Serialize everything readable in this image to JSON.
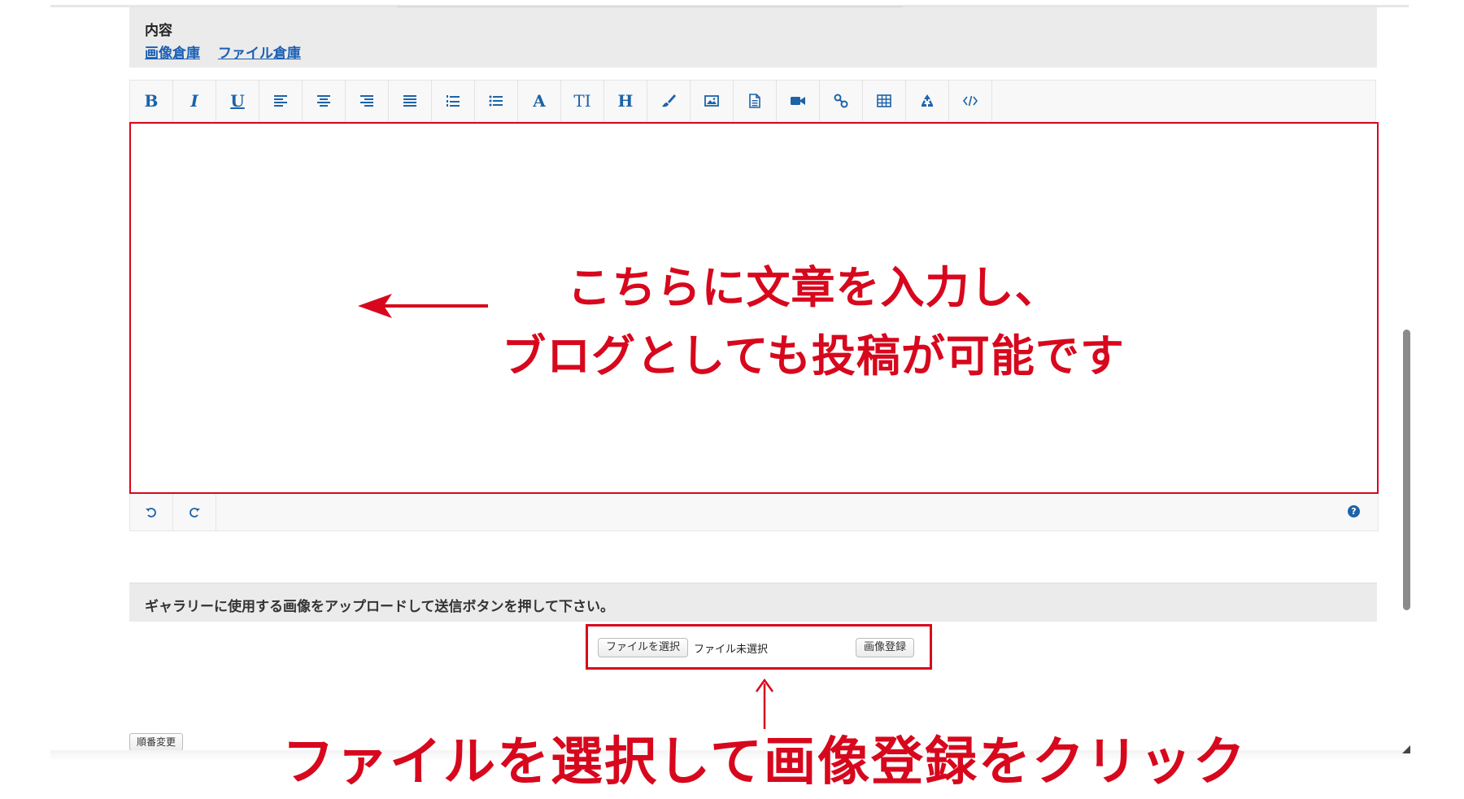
{
  "content_section": {
    "title": "内容",
    "links": [
      "画像倉庫",
      "ファイル倉庫"
    ]
  },
  "toolbar": {
    "buttons": [
      {
        "name": "bold-button",
        "label": "B",
        "icon": "bold-icon"
      },
      {
        "name": "italic-button",
        "label": "I",
        "icon": "italic-icon"
      },
      {
        "name": "underline-button",
        "label": "U",
        "icon": "underline-icon"
      },
      {
        "name": "align-left-button",
        "icon": "align-left-icon"
      },
      {
        "name": "align-center-button",
        "icon": "align-center-icon"
      },
      {
        "name": "align-right-button",
        "icon": "align-right-icon"
      },
      {
        "name": "justify-button",
        "icon": "justify-icon"
      },
      {
        "name": "ordered-list-button",
        "icon": "ordered-list-icon"
      },
      {
        "name": "unordered-list-button",
        "icon": "unordered-list-icon"
      },
      {
        "name": "font-button",
        "label": "A",
        "icon": "font-icon"
      },
      {
        "name": "font-size-button",
        "label": "TI",
        "icon": "font-size-icon"
      },
      {
        "name": "heading-button",
        "label": "H",
        "icon": "heading-icon"
      },
      {
        "name": "color-button",
        "icon": "brush-icon"
      },
      {
        "name": "insert-image-button",
        "icon": "image-icon"
      },
      {
        "name": "insert-file-button",
        "icon": "file-icon"
      },
      {
        "name": "insert-video-button",
        "icon": "video-icon"
      },
      {
        "name": "insert-link-button",
        "icon": "link-icon"
      },
      {
        "name": "insert-table-button",
        "icon": "table-icon"
      },
      {
        "name": "clear-format-button",
        "icon": "recycle-icon"
      },
      {
        "name": "code-view-button",
        "icon": "code-icon"
      }
    ]
  },
  "editor": {
    "annotation_line1": "こちらに文章を入力し、",
    "annotation_line2": "ブログとしても投稿が可能です"
  },
  "editor_footer": {
    "undo_icon": "undo-icon",
    "redo_icon": "redo-icon",
    "help_label": "?"
  },
  "gallery": {
    "instruction": "ギャラリーに使用する画像をアップロードして送信ボタンを押して下さい。",
    "choose_file_label": "ファイルを選択",
    "file_status": "ファイル未選択",
    "submit_label": "画像登録"
  },
  "reorder_label": "順番変更",
  "bottom_annotation": "ファイルを選択して画像登録をクリック",
  "colors": {
    "accent_red": "#d7081d",
    "link_blue": "#1a5fb4",
    "icon_blue": "#1d63a8"
  }
}
